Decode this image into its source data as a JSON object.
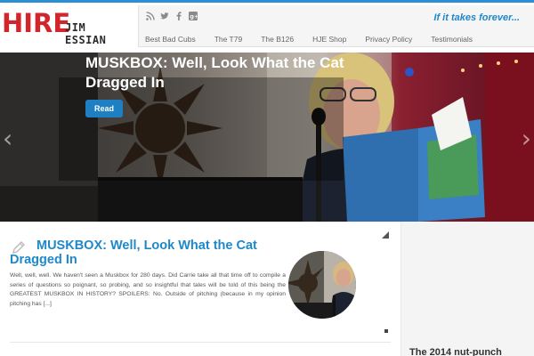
{
  "header": {
    "logo_main": "HIRE",
    "logo_sub": "JIM ESSIAN",
    "tagline": "If it takes forever...",
    "social_icons": [
      "rss-icon",
      "twitter-icon",
      "facebook-icon",
      "google-plus-icon"
    ],
    "nav": [
      "Best Bad Cubs",
      "The T79",
      "The B126",
      "HJE Shop",
      "Privacy Policy",
      "Testimonials"
    ],
    "accent_color": "#1e88c9",
    "brand_color": "#d1262c"
  },
  "slider": {
    "title": "MUSKBOX: Well, Look What the Cat Dragged In",
    "button_label": "Read",
    "prev_icon": "‹",
    "next_icon": "›"
  },
  "post": {
    "title": "MUSKBOX: Well, Look What the Cat Dragged In",
    "excerpt": "Well, well, well. We haven't seen a Muskbox for 280 days. Did Carrie take all that time off to compile a series of questions so poignant, so probing, and so insightful that tales will be told of this being the GREATEST MUSKBOX IN HISTORY? SPOILERS: No. Outside of pitching (because in my opinion pitching has [...]"
  },
  "sidebar": {
    "title": "The 2014 nut-punch"
  }
}
